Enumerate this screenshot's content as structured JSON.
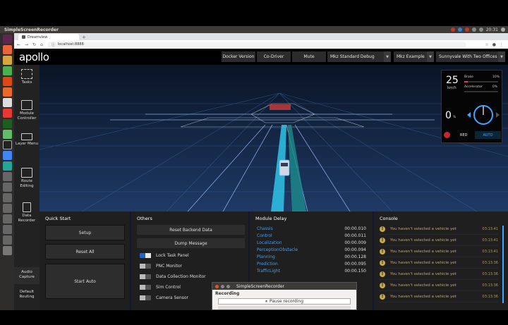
{
  "os": {
    "window_title": "SimpleScreenRecorder",
    "clock": "20:31"
  },
  "browser": {
    "tab_label": "Dreamview",
    "new_tab": "+",
    "url": "localhost:8888"
  },
  "app": {
    "logo": "apollo",
    "header": {
      "docker_version": "Docker Version",
      "co_driver": "Co-Driver",
      "mute": "Mute",
      "mode": "Mkz Standard Debug",
      "vehicle": "Mkz Example",
      "map": "Sunnyvale With Two Offices"
    },
    "nav": [
      {
        "label": "Tasks",
        "icon": "grid-icon"
      },
      {
        "label": "Module Controller",
        "icon": "module-icon"
      },
      {
        "label": "Layer Menu",
        "icon": "layers-icon"
      },
      {
        "label": "Route Editing",
        "icon": "route-icon"
      },
      {
        "label": "Data Recorder",
        "icon": "document-icon"
      },
      {
        "label": "Audio Capture",
        "icon": ""
      },
      {
        "label": "Default Routing",
        "icon": ""
      }
    ],
    "dashboard": {
      "speed": "25",
      "speed_unit": "km/h",
      "brake_label": "Brake",
      "brake_pct": "10%",
      "brake_value": 0.1,
      "accel_label": "Accelerator",
      "accel_pct": "0%",
      "accel_value": 0.0,
      "gear": "0",
      "gear_unit": "%",
      "traffic_light": "RED",
      "drive_mode": "AUTO",
      "colors": {
        "brake": "#d44",
        "accel": "#3ea6ff",
        "auto": "#3ea6ff"
      }
    },
    "quick_start": {
      "title": "Quick Start",
      "setup": "Setup",
      "reset_all": "Reset All",
      "start_auto": "Start Auto"
    },
    "others": {
      "title": "Others",
      "reset_backend": "Reset Backend Data",
      "dump_message": "Dump Message",
      "toggles": [
        {
          "label": "Lock Task Panel",
          "on": true
        },
        {
          "label": "PNC Monitor",
          "on": false
        },
        {
          "label": "Data Collection Monitor",
          "on": false
        },
        {
          "label": "Sim Control",
          "on": false
        },
        {
          "label": "Camera Sensor",
          "on": false
        }
      ]
    },
    "module_delay": {
      "title": "Module Delay",
      "rows": [
        {
          "name": "Chassis",
          "time": "00:00.010"
        },
        {
          "name": "Control",
          "time": "00:00.011"
        },
        {
          "name": "Localization",
          "time": "00:00.009"
        },
        {
          "name": "PerceptionObstacle",
          "time": "00:00.094"
        },
        {
          "name": "Planning",
          "time": "00:00.128"
        },
        {
          "name": "Prediction",
          "time": "00:00.095"
        },
        {
          "name": "TrafficLight",
          "time": "00:00.150"
        }
      ]
    },
    "console": {
      "title": "Console",
      "rows": [
        {
          "msg": "You haven't selected a vehicle yet",
          "time": "03:13:41"
        },
        {
          "msg": "You haven't selected a vehicle yet",
          "time": "03:13:41"
        },
        {
          "msg": "You haven't selected a vehicle yet",
          "time": "03:13:41"
        },
        {
          "msg": "You haven't selected a vehicle yet",
          "time": "03:13:36"
        },
        {
          "msg": "You haven't selected a vehicle yet",
          "time": "03:13:36"
        },
        {
          "msg": "You haven't selected a vehicle yet",
          "time": "03:13:36"
        },
        {
          "msg": "You haven't selected a vehicle yet",
          "time": "03:13:36"
        }
      ]
    }
  },
  "recorder": {
    "title": "SimpleScreenRecorder",
    "section": "Recording",
    "pause_button": "Pause recording"
  }
}
